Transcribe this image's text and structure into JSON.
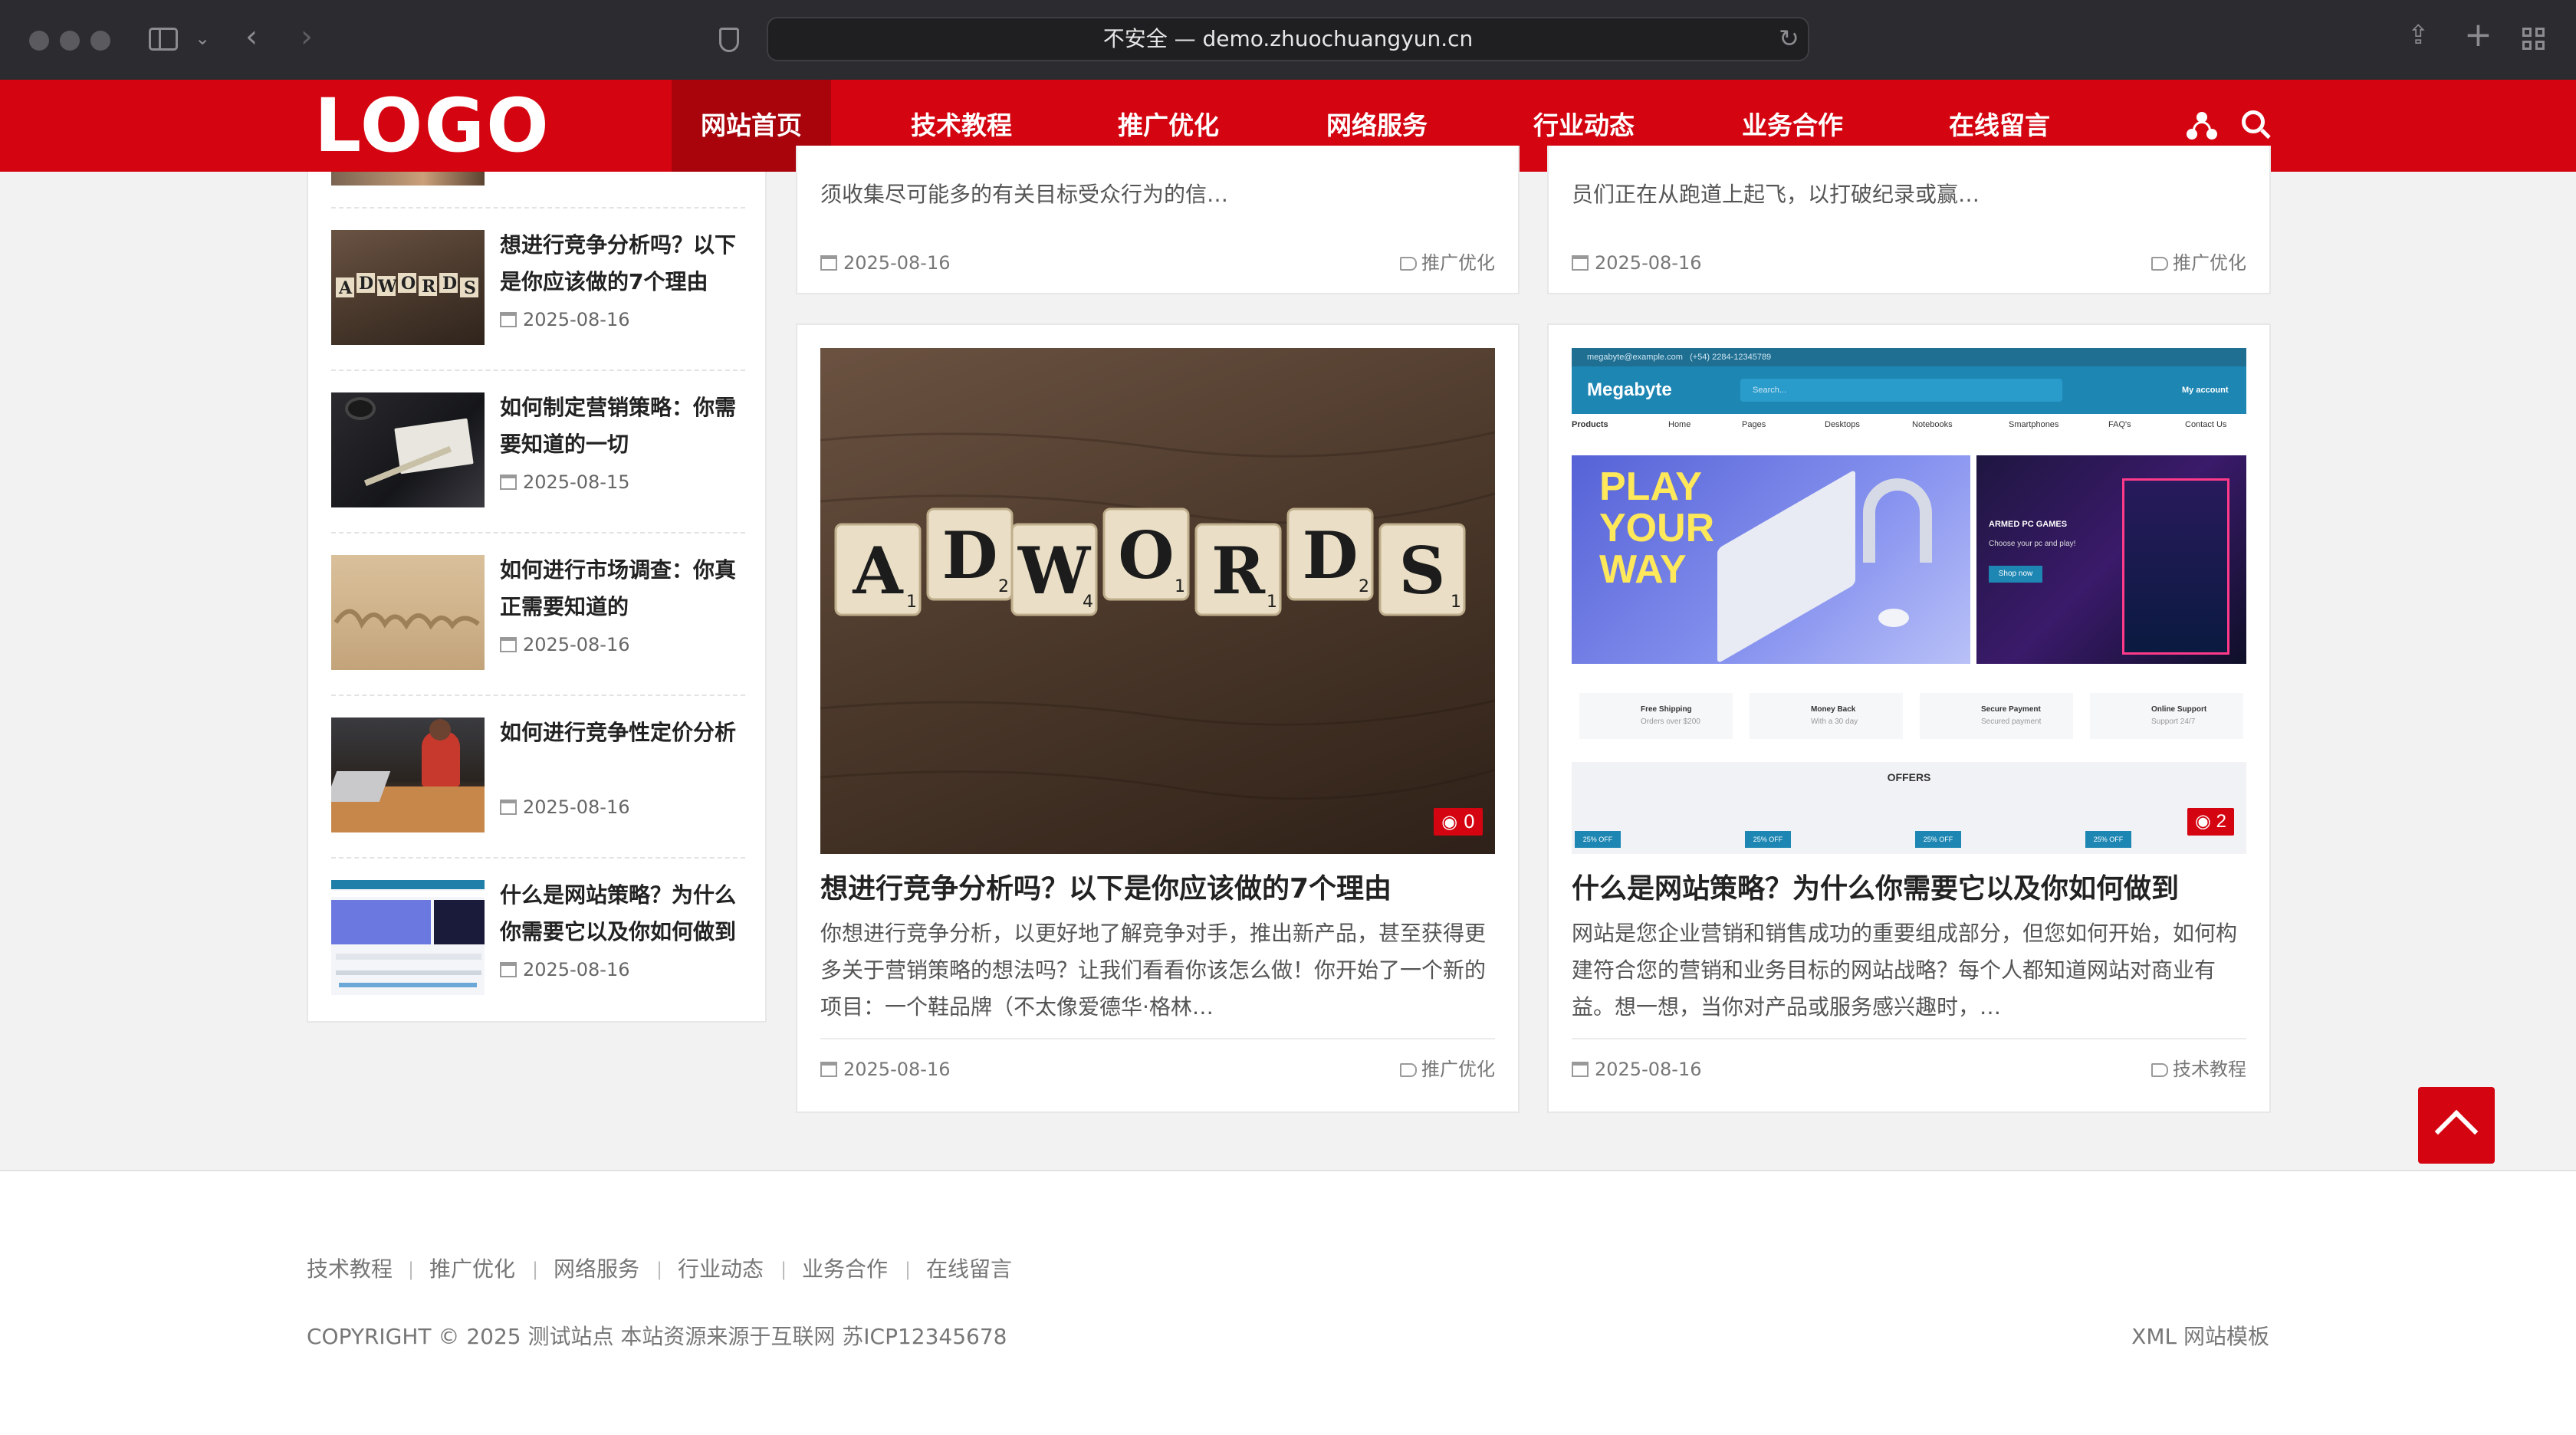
{
  "browser": {
    "url_text": "不安全 — demo.zhuochuangyun.cn"
  },
  "header": {
    "logo": "LOGO",
    "nav": [
      "网站首页",
      "技术教程",
      "推广优化",
      "网络服务",
      "行业动态",
      "业务合作",
      "在线留言"
    ],
    "active_index": 0
  },
  "sidebar": {
    "items": [
      {
        "title": "想进行竞争分析吗？以下是你应该做的7个理由",
        "date": "2025-08-16"
      },
      {
        "title": "如何制定营销策略：你需要知道的一切",
        "date": "2025-08-15"
      },
      {
        "title": "如何进行市场调查：你真正需要知道的",
        "date": "2025-08-16"
      },
      {
        "title": "如何进行竞争性定价分析",
        "date": "2025-08-16"
      },
      {
        "title": "什么是网站策略？为什么你需要它以及你如何做到",
        "date": "2025-08-16"
      }
    ]
  },
  "top_cards": [
    {
      "excerpt": "须收集尽可能多的有关目标受众行为的信…",
      "date": "2025-08-16",
      "category": "推广优化"
    },
    {
      "excerpt": "员们正在从跑道上起飞，以打破纪录或赢…",
      "date": "2025-08-16",
      "category": "推广优化"
    }
  ],
  "cards": [
    {
      "title": "想进行竞争分析吗？以下是你应该做的7个理由",
      "excerpt": "你想进行竞争分析，以更好地了解竞争对手，推出新产品，甚至获得更多关于营销策略的想法吗？让我们看看你该怎么做！你开始了一个新的项目：一个鞋品牌（不太像爱德华·格林…",
      "date": "2025-08-16",
      "category": "推广优化",
      "views": "0",
      "tiles": [
        "A",
        "D",
        "W",
        "O",
        "R",
        "D",
        "S"
      ],
      "tile_scores": [
        "1",
        "2",
        "4",
        "1",
        "1",
        "2",
        "1"
      ]
    },
    {
      "title": "什么是网站策略？为什么你需要它以及你如何做到",
      "excerpt": "网站是您企业营销和销售成功的重要组成部分，但您如何开始，如何构建符合您的营销和业务目标的网站战略？每个人都知道网站对商业有益。想一想，当你对产品或服务感兴趣时，…",
      "date": "2025-08-16",
      "category": "技术教程",
      "views": "2",
      "mock": {
        "email": "megabyte@example.com",
        "phone": "(+54) 2284-12345789",
        "brand": "Megabyte",
        "search": "Search...",
        "account": "My account",
        "menu": [
          "Products",
          "Home",
          "Pages",
          "Desktops",
          "Notebooks",
          "Smartphones",
          "FAQ's",
          "Contact Us"
        ],
        "hero": "PLAY YOUR WAY",
        "side_title": "ARMED PC GAMES",
        "side_text": "Choose your pc and play!",
        "side_btn": "Shop now",
        "features": [
          {
            "title": "Free Shipping",
            "sub": "Orders over $200"
          },
          {
            "title": "Money Back",
            "sub": "With a 30 day"
          },
          {
            "title": "Secure Payment",
            "sub": "Secured payment"
          },
          {
            "title": "Online Support",
            "sub": "Support 24/7"
          }
        ],
        "offers": "OFFERS",
        "badge": "25% OFF"
      }
    }
  ],
  "footer": {
    "links": [
      "技术教程",
      "推广优化",
      "网络服务",
      "行业动态",
      "业务合作",
      "在线留言"
    ],
    "copyright": "COPYRIGHT © 2025 测试站点 本站资源来源于互联网 苏ICP12345678",
    "right": "XML 网站模板"
  },
  "colors": {
    "brand_red": "#d40511",
    "brand_dark_red": "#a9030b",
    "chrome": "#2c2c30"
  },
  "icons": [
    "sidebar-toggle-icon",
    "back-icon",
    "forward-icon",
    "shield-icon",
    "reload-icon",
    "share-icon",
    "new-tab-icon",
    "tab-overview-icon",
    "user-icon",
    "search-icon",
    "calendar-icon",
    "tag-icon",
    "eye-icon",
    "arrow-up-icon"
  ]
}
